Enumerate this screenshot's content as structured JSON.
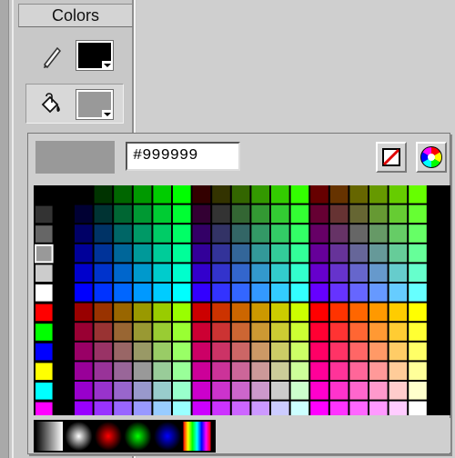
{
  "panel": {
    "title": "Colors",
    "stroke_color": "#000000",
    "fill_color": "#999999",
    "stroke_icon": "pencil-icon",
    "fill_icon": "paint-bucket-icon"
  },
  "palette": {
    "preview_color": "#999999",
    "hex_value": "#999999",
    "no_color_icon": "no-color-icon",
    "picker_icon": "color-wheel-icon",
    "left_column_colors": [
      "#000000",
      "#333333",
      "#666666",
      "#999999",
      "#CCCCCC",
      "#FFFFFF",
      "#FF0000",
      "#00FF00",
      "#0000FF",
      "#FFFF00",
      "#00FFFF",
      "#FF00FF"
    ],
    "selected_left_index": 3,
    "gradients": [
      "black-white-linear",
      "white-black-radial",
      "red-radial",
      "green-radial",
      "blue-radial",
      "rainbow-linear"
    ]
  }
}
